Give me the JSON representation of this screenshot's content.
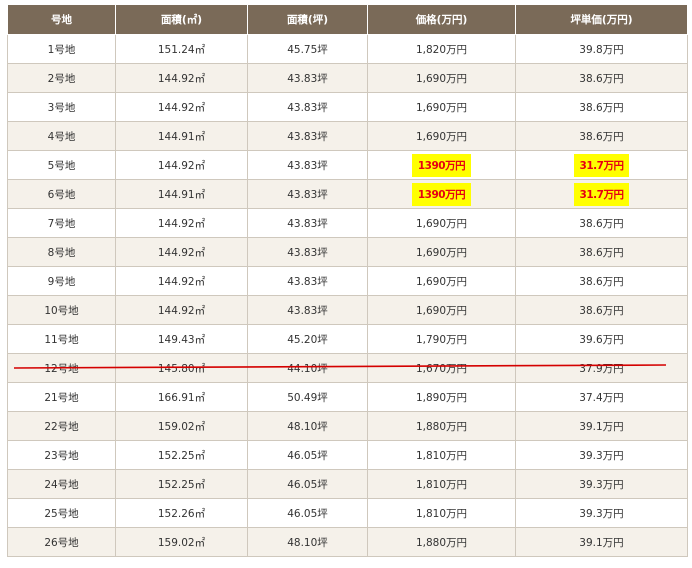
{
  "headers": [
    "号地",
    "面積(㎡)",
    "面積(坪)",
    "価格(万円)",
    "坪単価(万円)"
  ],
  "rows": [
    {
      "lot": "1号地",
      "area_m2": "151.24㎡",
      "area_tsubo": "45.75坪",
      "price": "1,820万円",
      "unit_price": "39.8万円",
      "highlight": false,
      "strike": false
    },
    {
      "lot": "2号地",
      "area_m2": "144.92㎡",
      "area_tsubo": "43.83坪",
      "price": "1,690万円",
      "unit_price": "38.6万円",
      "highlight": false,
      "strike": false
    },
    {
      "lot": "3号地",
      "area_m2": "144.92㎡",
      "area_tsubo": "43.83坪",
      "price": "1,690万円",
      "unit_price": "38.6万円",
      "highlight": false,
      "strike": false
    },
    {
      "lot": "4号地",
      "area_m2": "144.91㎡",
      "area_tsubo": "43.83坪",
      "price": "1,690万円",
      "unit_price": "38.6万円",
      "highlight": false,
      "strike": false
    },
    {
      "lot": "5号地",
      "area_m2": "144.92㎡",
      "area_tsubo": "43.83坪",
      "price": "1390万円",
      "unit_price": "31.7万円",
      "highlight": true,
      "strike": false
    },
    {
      "lot": "6号地",
      "area_m2": "144.91㎡",
      "area_tsubo": "43.83坪",
      "price": "1390万円",
      "unit_price": "31.7万円",
      "highlight": true,
      "strike": false
    },
    {
      "lot": "7号地",
      "area_m2": "144.92㎡",
      "area_tsubo": "43.83坪",
      "price": "1,690万円",
      "unit_price": "38.6万円",
      "highlight": false,
      "strike": false
    },
    {
      "lot": "8号地",
      "area_m2": "144.92㎡",
      "area_tsubo": "43.83坪",
      "price": "1,690万円",
      "unit_price": "38.6万円",
      "highlight": false,
      "strike": false
    },
    {
      "lot": "9号地",
      "area_m2": "144.92㎡",
      "area_tsubo": "43.83坪",
      "price": "1,690万円",
      "unit_price": "38.6万円",
      "highlight": false,
      "strike": false
    },
    {
      "lot": "10号地",
      "area_m2": "144.92㎡",
      "area_tsubo": "43.83坪",
      "price": "1,690万円",
      "unit_price": "38.6万円",
      "highlight": false,
      "strike": false
    },
    {
      "lot": "11号地",
      "area_m2": "149.43㎡",
      "area_tsubo": "45.20坪",
      "price": "1,790万円",
      "unit_price": "39.6万円",
      "highlight": false,
      "strike": false
    },
    {
      "lot": "12号地",
      "area_m2": "145.80㎡",
      "area_tsubo": "44.10坪",
      "price": "1,670万円",
      "unit_price": "37.9万円",
      "highlight": false,
      "strike": true
    },
    {
      "lot": "21号地",
      "area_m2": "166.91㎡",
      "area_tsubo": "50.49坪",
      "price": "1,890万円",
      "unit_price": "37.4万円",
      "highlight": false,
      "strike": false
    },
    {
      "lot": "22号地",
      "area_m2": "159.02㎡",
      "area_tsubo": "48.10坪",
      "price": "1,880万円",
      "unit_price": "39.1万円",
      "highlight": false,
      "strike": false
    },
    {
      "lot": "23号地",
      "area_m2": "152.25㎡",
      "area_tsubo": "46.05坪",
      "price": "1,810万円",
      "unit_price": "39.3万円",
      "highlight": false,
      "strike": false
    },
    {
      "lot": "24号地",
      "area_m2": "152.25㎡",
      "area_tsubo": "46.05坪",
      "price": "1,810万円",
      "unit_price": "39.3万円",
      "highlight": false,
      "strike": false
    },
    {
      "lot": "25号地",
      "area_m2": "152.26㎡",
      "area_tsubo": "46.05坪",
      "price": "1,810万円",
      "unit_price": "39.3万円",
      "highlight": false,
      "strike": false
    },
    {
      "lot": "26号地",
      "area_m2": "159.02㎡",
      "area_tsubo": "48.10坪",
      "price": "1,880万円",
      "unit_price": "39.1万円",
      "highlight": false,
      "strike": false
    }
  ],
  "colors": {
    "header_bg": "#7a6a58",
    "highlight_bg": "#ffff00",
    "highlight_text": "#e60012",
    "strike_line": "#d40000"
  }
}
